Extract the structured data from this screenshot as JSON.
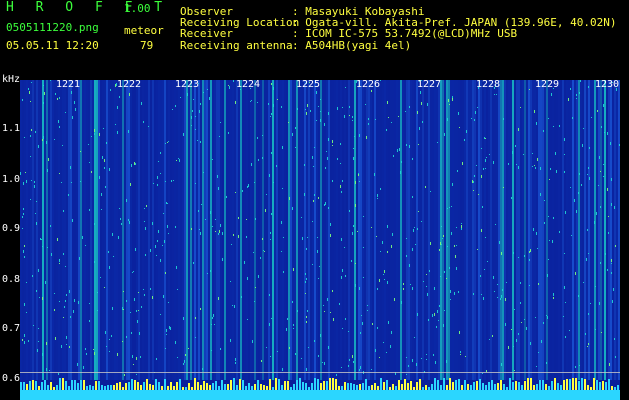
{
  "header": {
    "app_title": "H R O F F T",
    "version": "1.00",
    "filename": "0505111220.png",
    "mode": "meteor",
    "datetime": "05.05.11 12:20",
    "count": "79",
    "info": [
      {
        "label": "Observer",
        "value": ": Masayuki Kobayashi"
      },
      {
        "label": "Receiving Location",
        "value": ": Ogata-vill. Akita-Pref. JAPAN (139.96E, 40.02N)"
      },
      {
        "label": "Receiver",
        "value": ": ICOM IC-575 53.7492(@LCD)MHz USB"
      },
      {
        "label": "Receiving antenna",
        "value": ": A504HB(yagi 4el)"
      }
    ]
  },
  "plot": {
    "unit_label": "kHz",
    "freq_ticks": [
      "1.1",
      "1.0",
      "0.9",
      "0.8",
      "0.7",
      "0.6"
    ],
    "time_ticks": [
      "1221",
      "1222",
      "1223",
      "1224",
      "1225",
      "1226",
      "1227",
      "1228",
      "1229",
      "1230"
    ],
    "colors": {
      "background": "#000000",
      "text": "#3cff3c",
      "accent": "#ffff40",
      "spectrum_base": "#0a1f9a"
    }
  }
}
